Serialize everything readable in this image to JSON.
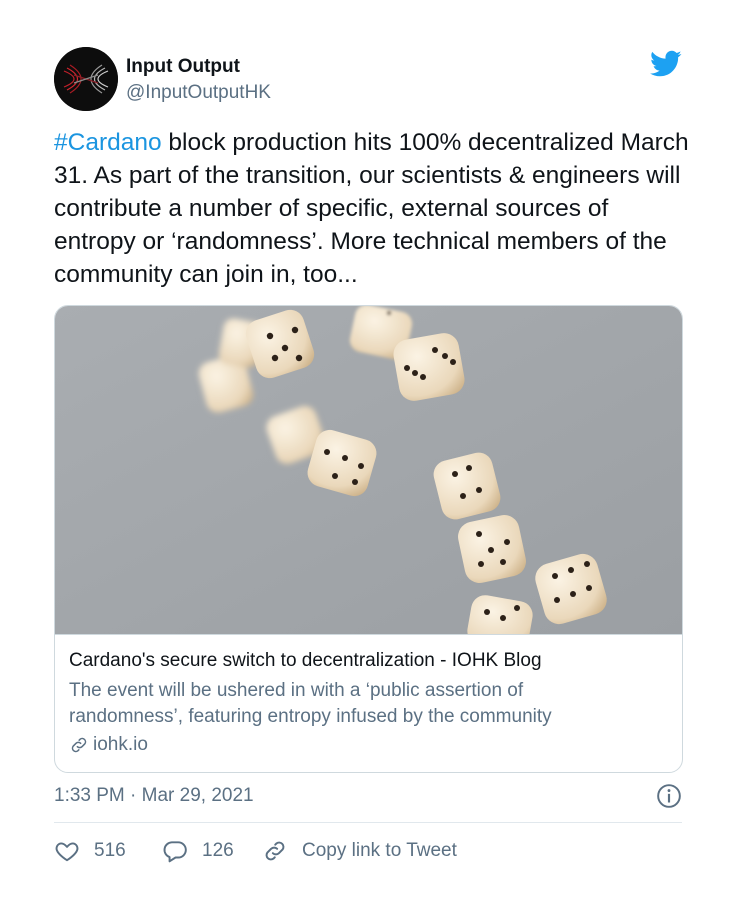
{
  "author": {
    "display_name": "Input Output",
    "handle": "@InputOutputHK",
    "avatar_icon": "iohk-logo-icon"
  },
  "brand_icon": "twitter-bird-icon",
  "tweet": {
    "hashtag": "#Cardano",
    "text": " block production hits 100% decentralized March 31. As part of the transition, our scientists & engineers will contribute a number of specific, external sources of entropy or ‘randomness’. More technical members of the community can join in, too..."
  },
  "card": {
    "image_icon": "flying-dice-image",
    "title": "Cardano's secure switch to decentralization - IOHK Blog",
    "description": "The event will be ushered in with a ‘public assertion of randomness’, featuring entropy infused by the community",
    "domain": "iohk.io"
  },
  "meta": {
    "timestamp": "1:33 PM · Mar 29, 2021"
  },
  "actions": {
    "likes": "516",
    "replies": "126",
    "copy_link": "Copy link to Tweet"
  },
  "colors": {
    "accent": "#1b95e0",
    "secondary_text": "#5b7083",
    "border": "#cfd9de"
  }
}
